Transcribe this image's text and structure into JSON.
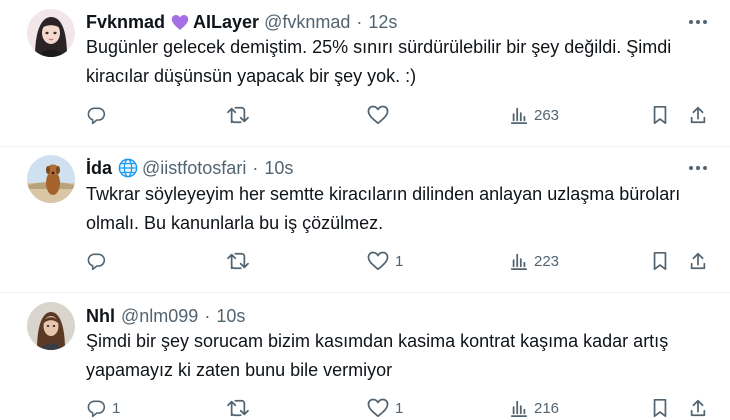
{
  "tweets": [
    {
      "name": "Fvknmad",
      "badge_icon": "purple-heart-icon",
      "badge_text": "AILayer",
      "handle": "@fvknmad",
      "time": "12s",
      "lines": [
        "Bugünler gelecek demiştim. 25% sınırı sürdürülebilir bir şey değildi. Şimdi",
        "kiracılar düşünsün yapacak bir şey yok. :)"
      ],
      "replies": "",
      "retweets": "",
      "likes": "",
      "views": "263"
    },
    {
      "name": "İda",
      "badge_icon": "globe-icon",
      "handle": "@iistfotosfari",
      "time": "10s",
      "lines": [
        "Twkrar söyleyeyim her semtte kiracıların dilinden anlayan uzlaşma büroları",
        "olmalı. Bu kanunlarla bu iş çözülmez."
      ],
      "replies": "",
      "retweets": "",
      "likes": "1",
      "views": "223"
    },
    {
      "name": "Nhl",
      "handle": "@nlm099",
      "time": "10s",
      "lines": [
        "Şimdi bir şey sorucam bizim kasımdan kasima kontrat kaşıma kadar artış",
        "yapamayız ki zaten bunu bile vermiyor"
      ],
      "replies": "1",
      "retweets": "",
      "likes": "1",
      "views": "216"
    }
  ],
  "colors": {
    "text": "#0f1419",
    "secondary": "#536471",
    "divider": "#eff3f4",
    "badge_purple": "#a66ee4",
    "globe_blue": "#1d9bf0"
  }
}
